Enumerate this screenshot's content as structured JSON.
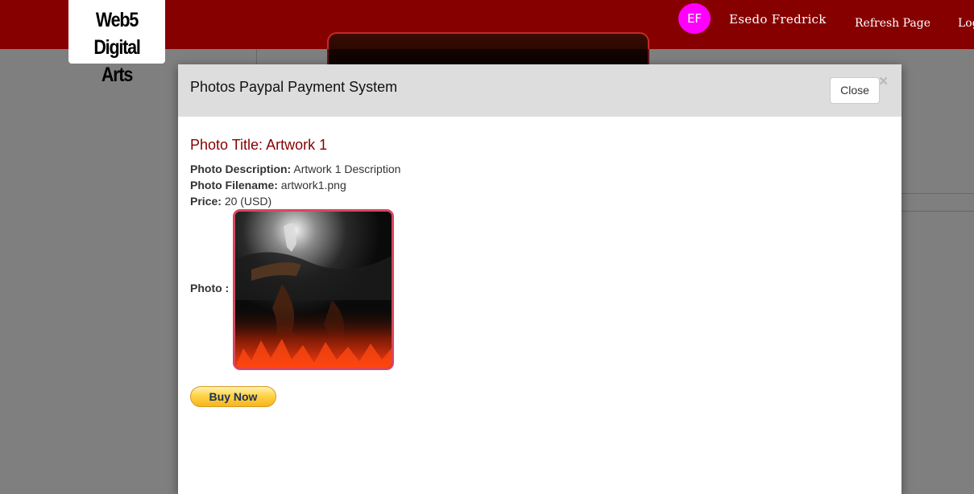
{
  "navbar": {
    "logo_line1": "Web5 Digital",
    "logo_line2": "Arts",
    "avatar_initials": "EF",
    "user_name": "Esedo Fredrick",
    "refresh_label": "Refresh Page",
    "logout_label": "Logout",
    "colors": {
      "bar": "#860000",
      "avatar": "#ff00ff"
    }
  },
  "modal": {
    "title": "Photos Paypal Payment System",
    "close_x": "×",
    "close_button_label": "Close",
    "photo_title_prefix": "Photo Title:",
    "photo_title": "Artwork 1",
    "description_label": "Photo Description:",
    "description": "Artwork 1 Description",
    "filename_label": "Photo Filename:",
    "filename": "artwork1.png",
    "price_label": "Price:",
    "price": "20 (USD)",
    "photo_label": "Photo :",
    "photo_icon": "artwork-image",
    "buy_button_label": "Buy Now",
    "colors": {
      "title": "#860000",
      "photo_border": "#d9465f",
      "buy_button": "#ffc439"
    }
  }
}
